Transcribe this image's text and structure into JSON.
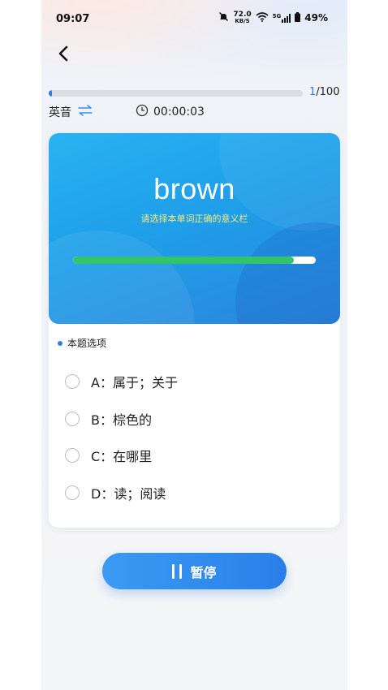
{
  "status_bar": {
    "time": "09:07",
    "net_speed_value": "72.0",
    "net_speed_unit": "KB/S",
    "network": "5G",
    "battery": "49%"
  },
  "progress": {
    "current": "1",
    "total": "/100",
    "fraction": 0.01
  },
  "mode": {
    "label": "英音"
  },
  "timer": {
    "value": "00:00:03"
  },
  "word_card": {
    "word": "brown",
    "hint": "请选择本单词正确的意义栏",
    "time_remaining_fraction": 0.91
  },
  "options_section": {
    "title": "本题选项",
    "options": [
      {
        "text": "A：属于；关于"
      },
      {
        "text": "B：棕色的"
      },
      {
        "text": "C：在哪里"
      },
      {
        "text": "D：读；阅读"
      }
    ]
  },
  "actions": {
    "pause_label": "暂停"
  },
  "colors": {
    "accent": "#2f7de0",
    "banner_start": "#29b3f2",
    "banner_end": "#2a86dc",
    "timer_bar": "#33c46a",
    "hint_text": "#f5e97a"
  }
}
